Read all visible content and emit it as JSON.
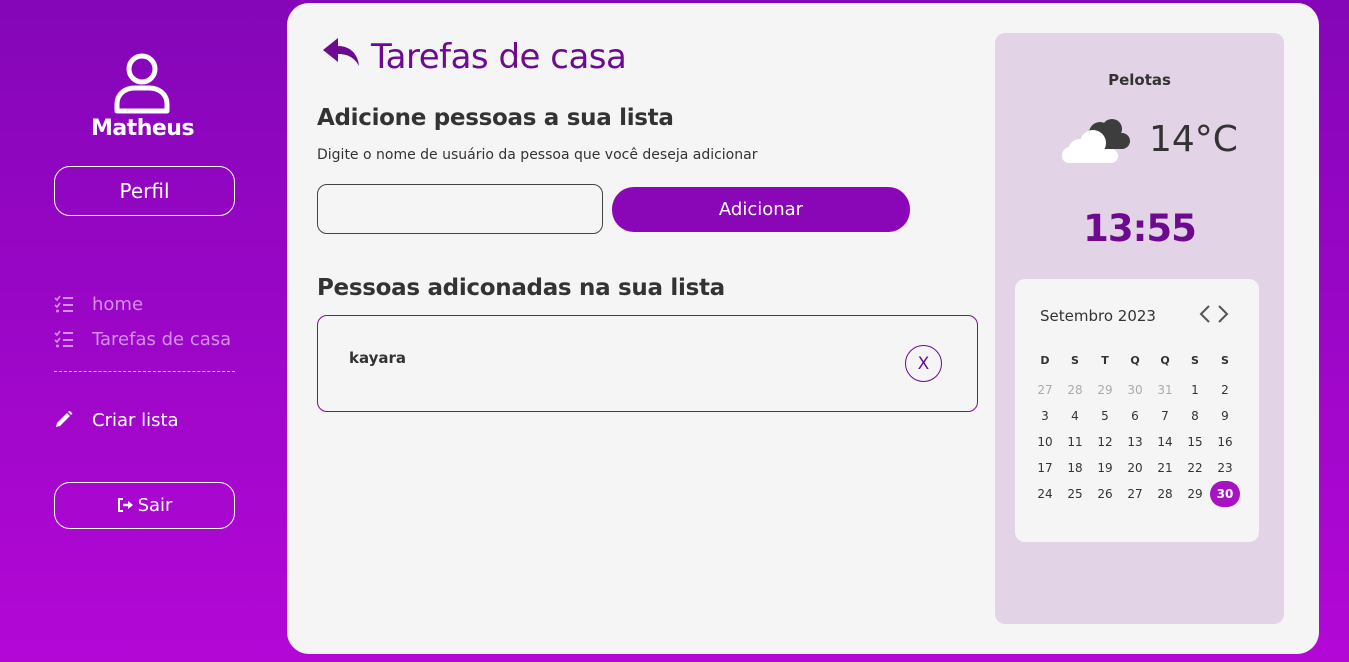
{
  "sidebar": {
    "username": "Matheus",
    "profile_button": "Perfil",
    "nav": [
      {
        "label": "home",
        "icon": "list-check-icon"
      },
      {
        "label": "Tarefas de casa",
        "icon": "list-check-icon"
      }
    ],
    "create_list": {
      "label": "Criar lista",
      "icon": "pencil-icon"
    },
    "logout_button": "Sair"
  },
  "main": {
    "title": "Tarefas de casa",
    "add_section": {
      "title": "Adicione pessoas a sua lista",
      "hint": "Digite o nome de usuário da pessoa que você deseja adicionar",
      "input_value": "",
      "add_button": "Adicionar"
    },
    "people_section": {
      "title": "Pessoas adiconadas na sua lista",
      "people": [
        {
          "name": "kayara",
          "remove_label": "X"
        }
      ]
    }
  },
  "weather": {
    "city": "Pelotas",
    "temperature": "14°C",
    "condition_icon": "cloud-icon",
    "time": "13:55"
  },
  "calendar": {
    "month_label": "Setembro 2023",
    "weekdays": [
      "D",
      "S",
      "T",
      "Q",
      "Q",
      "S",
      "S"
    ],
    "days": [
      {
        "d": "27",
        "muted": true
      },
      {
        "d": "28",
        "muted": true
      },
      {
        "d": "29",
        "muted": true
      },
      {
        "d": "30",
        "muted": true
      },
      {
        "d": "31",
        "muted": true
      },
      {
        "d": "1"
      },
      {
        "d": "2"
      },
      {
        "d": "3"
      },
      {
        "d": "4"
      },
      {
        "d": "5"
      },
      {
        "d": "6"
      },
      {
        "d": "7"
      },
      {
        "d": "8"
      },
      {
        "d": "9"
      },
      {
        "d": "10"
      },
      {
        "d": "11"
      },
      {
        "d": "12"
      },
      {
        "d": "13"
      },
      {
        "d": "14"
      },
      {
        "d": "15"
      },
      {
        "d": "16"
      },
      {
        "d": "17"
      },
      {
        "d": "18"
      },
      {
        "d": "19"
      },
      {
        "d": "20"
      },
      {
        "d": "21"
      },
      {
        "d": "22"
      },
      {
        "d": "23"
      },
      {
        "d": "24"
      },
      {
        "d": "25"
      },
      {
        "d": "26"
      },
      {
        "d": "27"
      },
      {
        "d": "28"
      },
      {
        "d": "29"
      },
      {
        "d": "30",
        "today": true
      }
    ]
  },
  "colors": {
    "brand_purple": "#8a07b8",
    "title_purple": "#6e0a8f",
    "today_highlight": "#a612c4"
  }
}
